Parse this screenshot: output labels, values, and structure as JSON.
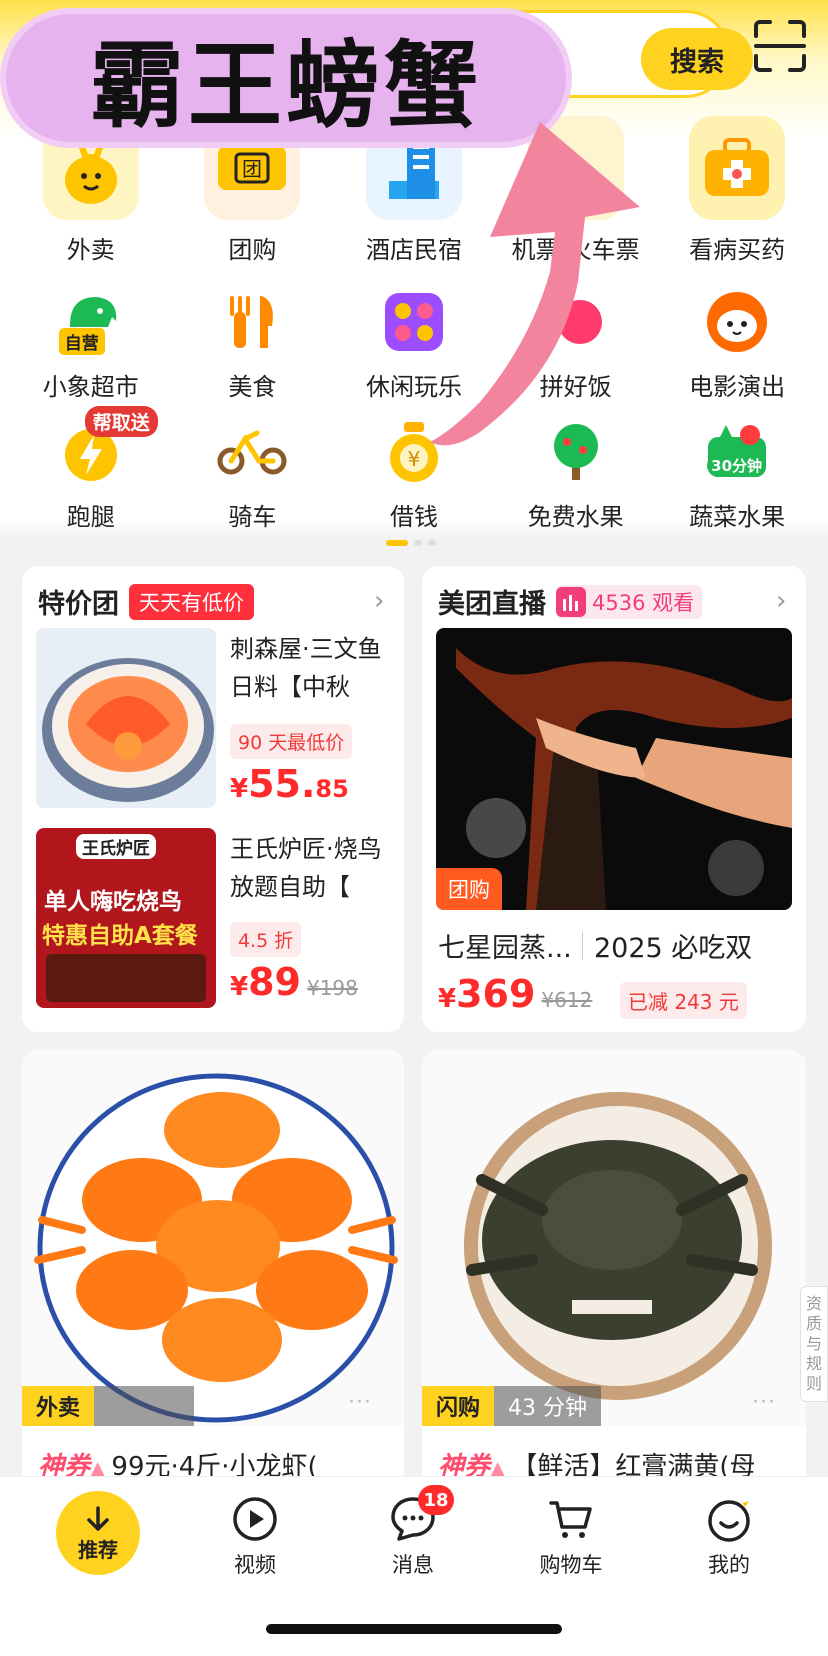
{
  "search": {
    "button_label": "搜索",
    "placeholder": ""
  },
  "overlay": {
    "title": "霸王螃蟹"
  },
  "grid": {
    "row1": [
      {
        "label": "外卖",
        "icon": "kangaroo-mascot-icon"
      },
      {
        "label": "团购",
        "icon": "ticket-tuan-icon"
      },
      {
        "label": "酒店民宿",
        "icon": "hotel-building-icon"
      },
      {
        "label": "机票/火车票",
        "icon": "travel-icon"
      },
      {
        "label": "看病买药",
        "icon": "medicine-box-icon"
      }
    ],
    "row2": [
      {
        "label": "小象超市",
        "icon": "elephant-icon",
        "badge": "自营"
      },
      {
        "label": "美食",
        "icon": "fork-knife-icon"
      },
      {
        "label": "休闲玩乐",
        "icon": "entertainment-icon"
      },
      {
        "label": "拼好饭",
        "icon": "pin-hao-fan-icon"
      },
      {
        "label": "电影演出",
        "icon": "cat-movie-icon"
      }
    ],
    "row3": [
      {
        "label": "跑腿",
        "icon": "lightning-run-icon",
        "badge": "帮取送"
      },
      {
        "label": "骑车",
        "icon": "bicycle-icon"
      },
      {
        "label": "借钱",
        "icon": "money-bag-icon"
      },
      {
        "label": "免费水果",
        "icon": "fruit-tree-icon"
      },
      {
        "label": "蔬菜水果",
        "icon": "vegetable-icon",
        "badge": "30分钟"
      }
    ]
  },
  "deals": {
    "title": "特价团",
    "tag": "天天有低价",
    "items": [
      {
        "title": "刺森屋·三文鱼日料【中秋",
        "tag": "90 天最低价",
        "currency": "¥",
        "price_int": "55.",
        "price_dec": "85",
        "orig": ""
      },
      {
        "title": "王氏炉匠·烧鸟放题自助【",
        "tag": "4.5 折",
        "currency": "¥",
        "price_int": "89",
        "price_dec": "",
        "orig": "¥198"
      }
    ],
    "img2_text": {
      "brand": "王氏炉匠",
      "line1": "单人嗨吃烧鸟",
      "line2": "特惠自助A套餐"
    }
  },
  "live": {
    "title": "美团直播",
    "viewers": "4536 观看",
    "badge": "团购",
    "name": "七星园蒸...",
    "subtitle": "2025 必吃双",
    "currency": "¥",
    "price": "369",
    "orig": "¥612",
    "discount": "已减 243 元"
  },
  "feed": [
    {
      "strip_y": "外卖",
      "strip_g": "",
      "quan": "神券",
      "text": "99元·4斤·小龙虾("
    },
    {
      "strip_y": "闪购",
      "strip_g": "43 分钟",
      "quan": "神券",
      "text": "【鲜活】红膏满黄(母"
    }
  ],
  "side_label": [
    "资",
    "质",
    "与",
    "规",
    "则"
  ],
  "tabbar": {
    "home": "推荐",
    "video": "视频",
    "messages": "消息",
    "messages_badge": "18",
    "cart": "购物车",
    "me": "我的"
  },
  "colors": {
    "brand_yellow": "#ffd21f",
    "price_red": "#ff2a2a",
    "overlay_pink": "#e7b3ef"
  }
}
